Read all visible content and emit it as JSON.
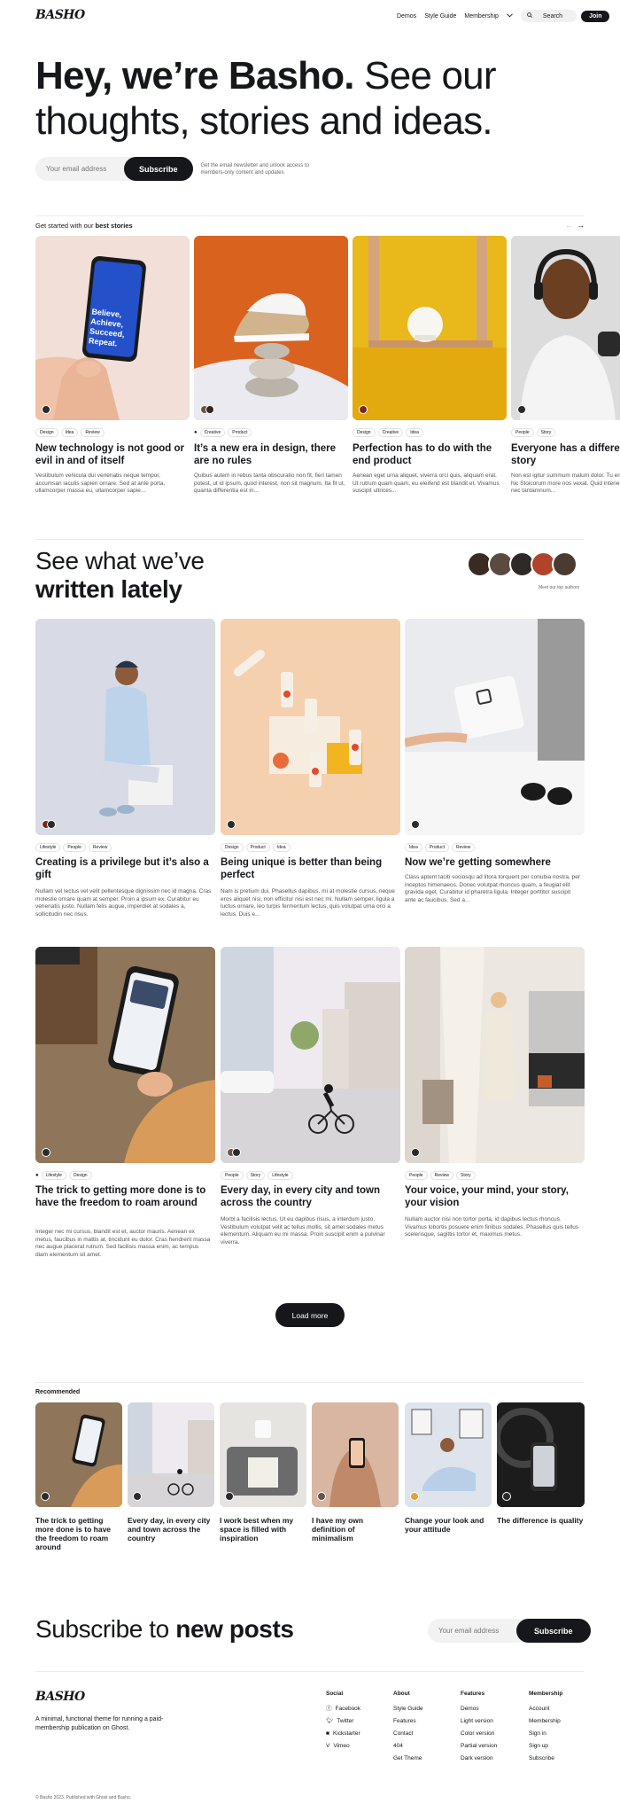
{
  "brand": {
    "logo": "BASHO"
  },
  "nav": {
    "items": [
      "Demos",
      "Style Guide",
      "Membership"
    ],
    "search": "Search",
    "join": "Join"
  },
  "hero": {
    "bold": "Hey, we’re Basho.",
    "rest": " See our thoughts, stories and ideas."
  },
  "subscribe": {
    "placeholder": "Your email address",
    "button": "Subscribe",
    "note": "Get the email newsletter and unlock access to members-only content and updates"
  },
  "best": {
    "prefix": "Get started with our ",
    "bold": "best stories"
  },
  "best_stories": [
    {
      "tags": [
        "Design",
        "Idea",
        "Review"
      ],
      "title": "New technology is not good or evil in and of itself",
      "excerpt": "Vestibulum vehicula dui venenatis neque tempor, accumsan iaculis sapien ornare. Sed at ante porta, ullamcorper massa eu, ullamcorper sapie...",
      "phone_text": "Believe, Achieve, Succeed, Repeat."
    },
    {
      "tags": [
        "Creative",
        "Product"
      ],
      "title": "It’s a new era in design, there are no rules",
      "excerpt": "Quibus autem in rebus tanta obscuratio non fit, fieri tamen potest, ut id ipsum, quod interest, non sit magnum. Ita fit ut, quanta differentia est in..."
    },
    {
      "tags": [
        "Design",
        "Creative",
        "Idea"
      ],
      "title": "Perfection has to do with the end product",
      "excerpt": "Aenean eget urna aliquet, viverra orci quis, aliquam erat. Ut rutrum quam quam, eu eleifend est blandit et. Vivamus suscipit ultrices..."
    },
    {
      "tags": [
        "People",
        "Story"
      ],
      "title": "Everyone has a different life story",
      "excerpt": "Non est igitur summum malum dolor. Tu enim ista lenius, hic Stoicorum more nos vexat. Quid interiestam non video nec tantamnum..."
    }
  ],
  "written": {
    "line1": "See what we’ve",
    "line2": "written lately",
    "authors_note": "Meet our top authors"
  },
  "posts": [
    {
      "tags": [
        "Lifestyle",
        "People",
        "Review"
      ],
      "title": "Creating is a privilege but it’s also a gift",
      "excerpt": "Nullam vel lectus vel velit pellentesque dignissim nec id magna. Cras molestie ornare quam at semper. Proin a ipsum ex. Curabitur eu venenatis justo. Nullam felis augue, imperdiet at sodales a, sollicitudin nec risus."
    },
    {
      "tags": [
        "Design",
        "Product",
        "Idea"
      ],
      "title": "Being unique is better than being perfect",
      "excerpt": "Nam is pretium dui. Phasellus dapibus, mi at molestie cursus, neque eros aliquet nisi, non efficitur nisi est nec mi. Nullam semper, ligula a luctus ornare, leo turpis fermentum lectus, quis volutpat urna orci a lectus. Duis e..."
    },
    {
      "tags": [
        "Idea",
        "Product",
        "Review"
      ],
      "title": "Now we’re getting somewhere",
      "excerpt": "Class aptent taciti sociosqu ad litora torquent per conubia nostra, per inceptos himenaeos. Donec volutpat rhoncus quam, a feugiat elit gravida eget. Curabitur id pharetra ligula. Integer porttitor suscipit ante ac faucibus. Sed a..."
    },
    {
      "tags": [
        "Lifestyle",
        "Design"
      ],
      "title": "The trick to getting more done is to have the freedom to roam around",
      "excerpt": "Integer nec mi cursus, blandit est et, auctor mauris. Aenean ex metus, faucibus in mattis at, tincidunt eu dolor. Cras hendrerit massa nec augue placerat rutrum. Sed facilisis massa enim, ac tempus diam elementum sit amet."
    },
    {
      "tags": [
        "People",
        "Story",
        "Lifestyle"
      ],
      "title": "Every day, in every city and town across the country",
      "excerpt": "Morbi a facilisis lectus. Ut eu dapibus risus, a interdum justo. Vestibulum volutpat velit ac tellus mollis, sit amet sodales metus elementum. Aliquam eu mi massa. Proin suscipit enim a pulvinar viverra."
    },
    {
      "tags": [
        "People",
        "Review",
        "Story"
      ],
      "title": "Your voice, your mind, your story, your vision",
      "excerpt": "Nullam auctor nisi non tortor porta, id dapibus lectus rhoncus. Vivamus lobortis posuere enim finibus sodales. Phasellus quis tellus scelerisque, sagittis tortor et, maximus metus."
    }
  ],
  "load_more": "Load more",
  "recommended": {
    "heading": "Recommended",
    "items": [
      "The trick to getting more done is to have the freedom to roam around",
      "Every day, in every city and town across the country",
      "I work best when my space is filled with inspiration",
      "I have my own definition of minimalism",
      "Change your look and your attitude",
      "The difference is quality"
    ]
  },
  "subscribe_posts": {
    "text": "Subscribe to ",
    "bold": "new posts",
    "placeholder": "Your email address",
    "button": "Subscribe"
  },
  "footer": {
    "description": "A minimal, functional theme for running a paid-membership publication on Ghost.",
    "columns": [
      {
        "heading": "Social",
        "links": [
          "Facebook",
          "Twitter",
          "Kickstarter",
          "Vimeo"
        ],
        "icons": [
          "facebook-icon",
          "twitter-icon",
          "kickstarter-icon",
          "vimeo-icon"
        ]
      },
      {
        "heading": "About",
        "links": [
          "Style Guide",
          "Features",
          "Contact",
          "404",
          "Get Theme"
        ]
      },
      {
        "heading": "Features",
        "links": [
          "Demos",
          "Light version",
          "Color version",
          "Partial version",
          "Dark version"
        ]
      },
      {
        "heading": "Membership",
        "links": [
          "Account",
          "Membership",
          "Sign in",
          "Sign up",
          "Subscribe"
        ]
      }
    ],
    "copyright": "© Basho 2023. Published with Ghost and Basho."
  },
  "colors": {
    "text": "#15171a",
    "button": "#15171a",
    "accent_orange": "#d9621f",
    "accent_yellow": "#e8b719"
  }
}
